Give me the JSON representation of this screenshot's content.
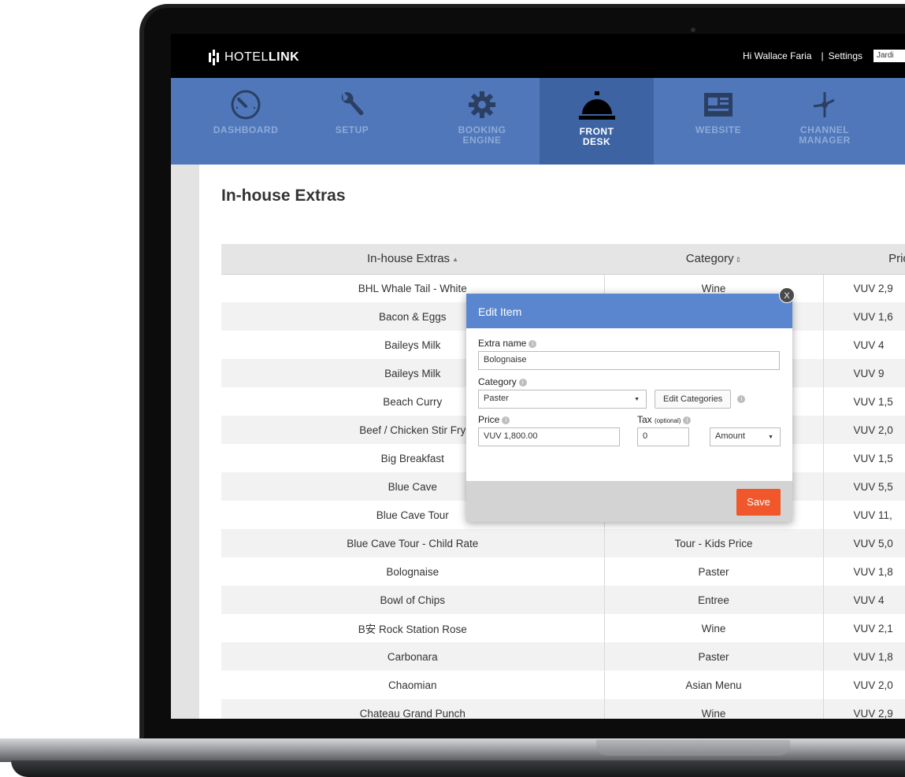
{
  "topbar": {
    "brand_prefix": "HOTEL",
    "brand_suffix": "LINK",
    "greeting": "Hi Wallace Faria",
    "separator": "|",
    "settings": "Settings",
    "property_select": "Jardi"
  },
  "nav": {
    "items": [
      {
        "label": "DASHBOARD",
        "icon": "speedometer-icon"
      },
      {
        "label": "SETUP",
        "icon": "wrench-icon"
      },
      {
        "label": "BOOKING\nENGINE",
        "icon": "gear-icon"
      },
      {
        "label": "FRONT\nDESK",
        "icon": "service-bell-icon",
        "active": true
      },
      {
        "label": "WEBSITE",
        "icon": "webpage-icon"
      },
      {
        "label": "CHANNEL\nMANAGER",
        "icon": "network-icon"
      }
    ]
  },
  "page": {
    "title": "In-house Extras"
  },
  "table": {
    "headers": [
      "In-house Extras",
      "Category",
      "Pric"
    ],
    "rows": [
      {
        "name": "BHL Whale Tail - White",
        "category": "Wine",
        "price": "VUV 2,9"
      },
      {
        "name": "Bacon & Eggs",
        "category": "",
        "price": "VUV 1,6"
      },
      {
        "name": "Baileys Milk",
        "category": "",
        "price": "VUV 4"
      },
      {
        "name": "Baileys Milk",
        "category": "",
        "price": "VUV 9"
      },
      {
        "name": "Beach Curry",
        "category": "",
        "price": "VUV 1,5"
      },
      {
        "name": "Beef / Chicken Stir Fry",
        "category": "",
        "price": "VUV 2,0"
      },
      {
        "name": "Big Breakfast",
        "category": "",
        "price": "VUV 1,5"
      },
      {
        "name": "Blue Cave",
        "category": "",
        "price": "VUV 5,5"
      },
      {
        "name": "Blue Cave Tour",
        "category": "",
        "price": "VUV 11,"
      },
      {
        "name": "Blue Cave Tour - Child Rate",
        "category": "Tour - Kids Price",
        "price": "VUV 5,0"
      },
      {
        "name": "Bolognaise",
        "category": "Paster",
        "price": "VUV 1,8"
      },
      {
        "name": "Bowl of Chips",
        "category": "Entree",
        "price": "VUV 4"
      },
      {
        "name": "B安 Rock Station Rose",
        "category": "Wine",
        "price": "VUV 2,1"
      },
      {
        "name": "Carbonara",
        "category": "Paster",
        "price": "VUV 1,8"
      },
      {
        "name": "Chaomian",
        "category": "Asian Menu",
        "price": "VUV 2,0"
      },
      {
        "name": "Chateau Grand Punch",
        "category": "Wine",
        "price": "VUV 2,9"
      }
    ]
  },
  "modal": {
    "title": "Edit Item",
    "close": "X",
    "extra_name_label": "Extra name",
    "extra_name_value": "Bolognaise",
    "category_label": "Category",
    "category_value": "Paster",
    "edit_categories": "Edit Categories",
    "price_label": "Price",
    "price_value": "VUV 1,800.00",
    "tax_label": "Tax",
    "tax_optional": "(optional)",
    "tax_value": "0",
    "tax_type": "Amount",
    "save": "Save"
  },
  "colors": {
    "nav_bg": "#4f77b9",
    "nav_active": "#3d63a3",
    "modal_header": "#5a86cf",
    "save_button": "#f0572a"
  }
}
